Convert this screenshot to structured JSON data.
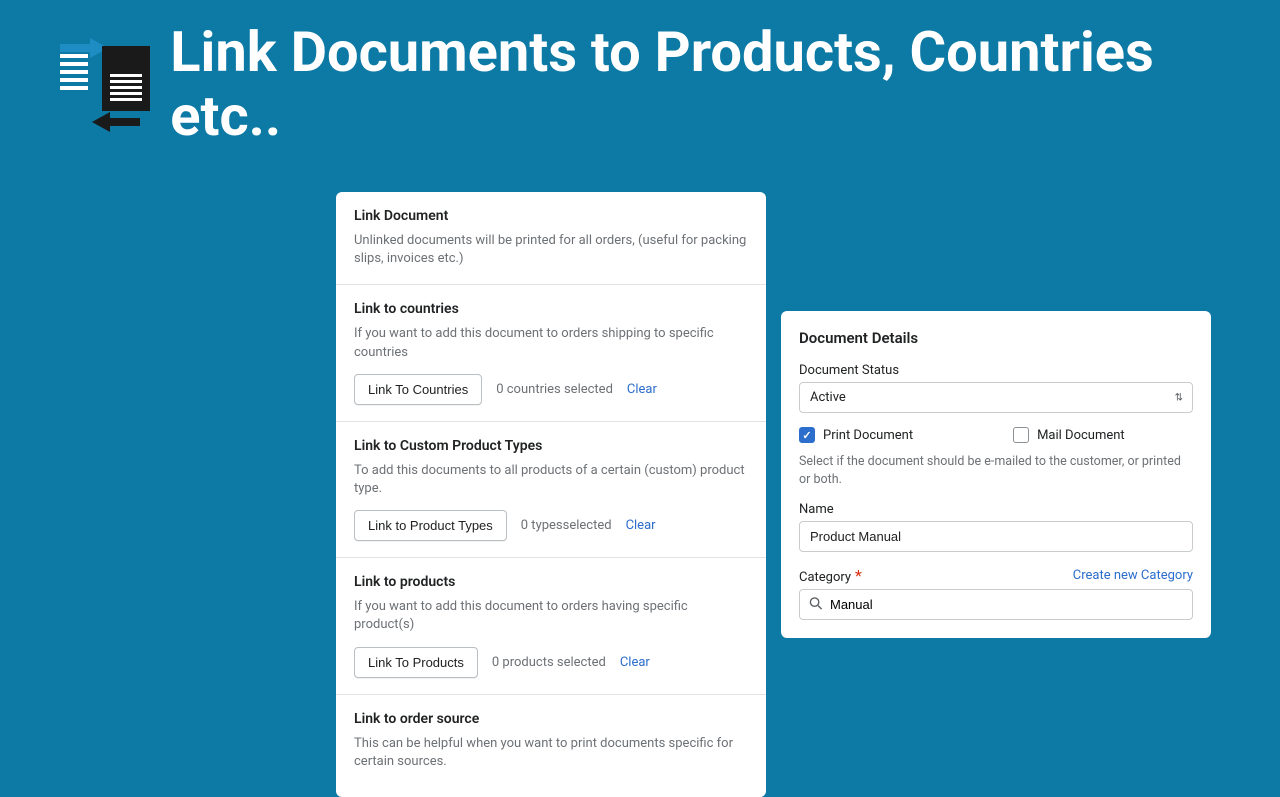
{
  "title": "Link Documents to Products, Countries etc..",
  "linkPanel": {
    "heading": "Link Document",
    "intro": "Unlinked documents will be printed for all orders, (useful for packing slips, invoices etc.)",
    "countries": {
      "title": "Link to countries",
      "desc": "If you want to add this document to orders shipping to specific countries",
      "btn": "Link To Countries",
      "status": "0 countries selected",
      "clear": "Clear"
    },
    "types": {
      "title": "Link to Custom Product Types",
      "desc": "To add this documents to all products of a certain (custom) product type.",
      "btn": "Link to Product Types",
      "status": "0 typesselected",
      "clear": "Clear"
    },
    "products": {
      "title": "Link to products",
      "desc": "If you want to add this document to orders having specific product(s)",
      "btn": "Link To Products",
      "status": "0 products selected",
      "clear": "Clear"
    },
    "source": {
      "title": "Link to order source",
      "desc": "This can be helpful when you want to print documents specific for certain sources."
    }
  },
  "details": {
    "heading": "Document Details",
    "statusLabel": "Document Status",
    "statusValue": "Active",
    "printLabel": "Print Document",
    "mailLabel": "Mail Document",
    "help": "Select if the document should be e-mailed to the customer, or printed or both.",
    "nameLabel": "Name",
    "nameValue": "Product Manual",
    "categoryLabel": "Category",
    "createCategory": "Create new Category",
    "categoryValue": "Manual"
  }
}
